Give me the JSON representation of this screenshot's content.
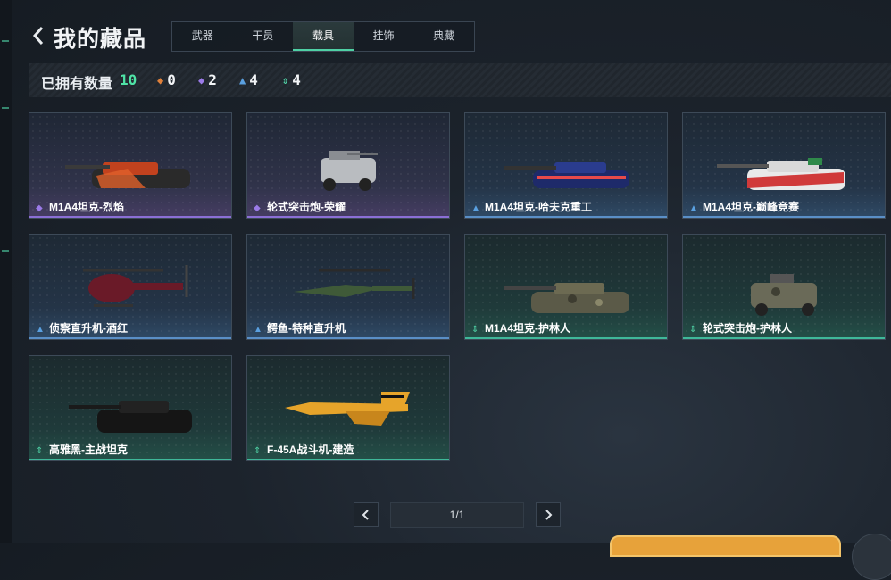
{
  "header": {
    "title": "我的藏品",
    "tabs": [
      "武器",
      "干员",
      "载具",
      "挂饰",
      "典藏"
    ],
    "active_tab": "载具"
  },
  "stats": {
    "label": "已拥有数量",
    "total": "10",
    "rarities": [
      {
        "icon": "orange-diamond-icon",
        "color": "#e0803a",
        "count": "0"
      },
      {
        "icon": "purple-diamond-icon",
        "color": "#9b7be8",
        "count": "2"
      },
      {
        "icon": "blue-triangle-icon",
        "color": "#5aa0e0",
        "count": "4"
      },
      {
        "icon": "green-arrows-icon",
        "color": "#4fd1a5",
        "count": "4"
      }
    ]
  },
  "items": [
    {
      "name": "M1A4坦克-烈焰",
      "rarity": "purple"
    },
    {
      "name": "轮式突击炮-荣耀",
      "rarity": "purple"
    },
    {
      "name": "M1A4坦克-哈夫克重工",
      "rarity": "blue"
    },
    {
      "name": "M1A4坦克-巅峰竞赛",
      "rarity": "blue"
    },
    {
      "name": "侦察直升机-酒红",
      "rarity": "blue"
    },
    {
      "name": "鳄鱼-特种直升机",
      "rarity": "blue"
    },
    {
      "name": "M1A4坦克-护林人",
      "rarity": "green"
    },
    {
      "name": "轮式突击炮-护林人",
      "rarity": "green"
    },
    {
      "name": "高雅黑-主战坦克",
      "rarity": "green"
    },
    {
      "name": "F-45A战斗机-建造",
      "rarity": "green"
    }
  ],
  "pagination": {
    "label": "1/1"
  }
}
